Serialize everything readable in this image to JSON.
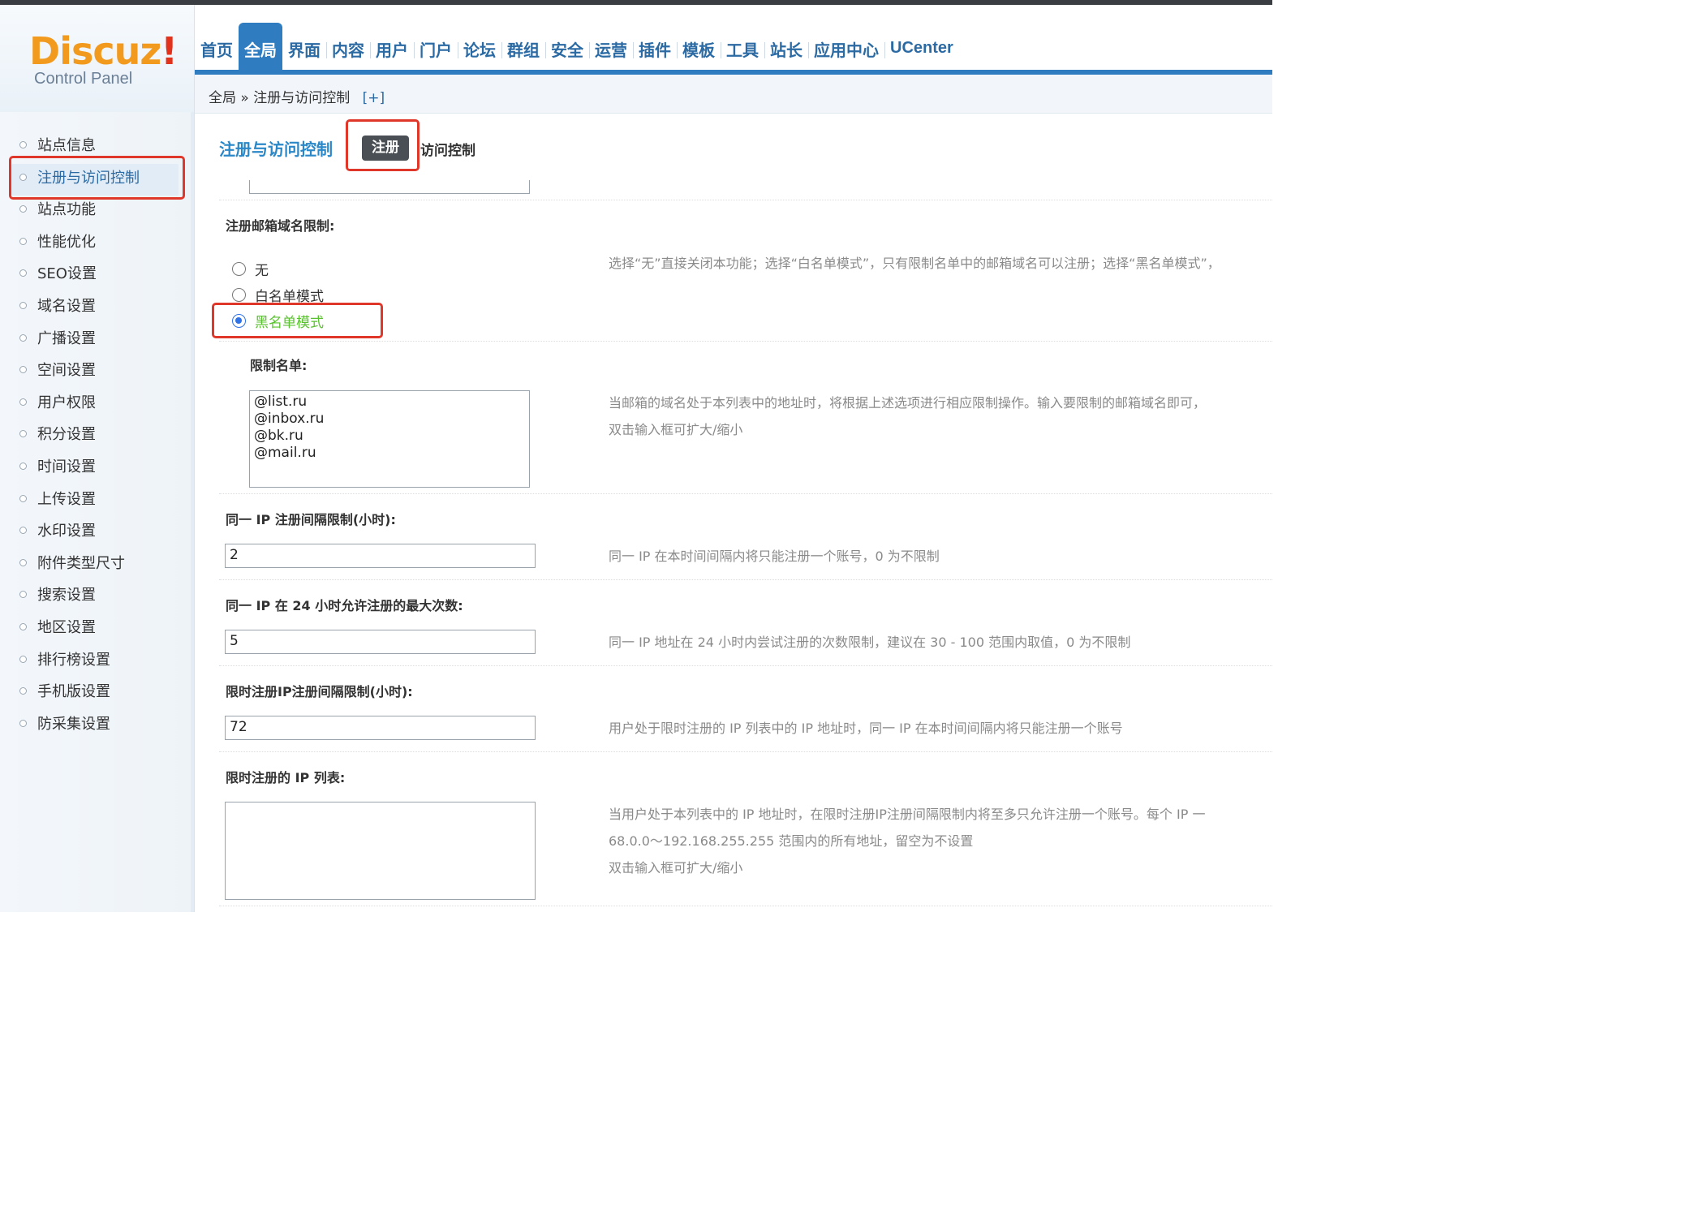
{
  "logo": {
    "brand": "Discuz",
    "bang": "!",
    "sub": "Control Panel"
  },
  "nav": {
    "items": [
      {
        "label": "首页",
        "active": false
      },
      {
        "label": "全局",
        "active": true
      },
      {
        "label": "界面",
        "active": false
      },
      {
        "label": "内容",
        "active": false
      },
      {
        "label": "用户",
        "active": false
      },
      {
        "label": "门户",
        "active": false
      },
      {
        "label": "论坛",
        "active": false
      },
      {
        "label": "群组",
        "active": false
      },
      {
        "label": "安全",
        "active": false
      },
      {
        "label": "运营",
        "active": false
      },
      {
        "label": "插件",
        "active": false
      },
      {
        "label": "模板",
        "active": false
      },
      {
        "label": "工具",
        "active": false
      },
      {
        "label": "站长",
        "active": false
      },
      {
        "label": "应用中心",
        "active": false
      },
      {
        "label": "UCenter",
        "active": false
      }
    ]
  },
  "breadcrumb": {
    "root": "全局",
    "sep": "»",
    "current": "注册与访问控制",
    "plus": "[+]"
  },
  "sidebar": {
    "items": [
      {
        "label": "站点信息",
        "active": false
      },
      {
        "label": "注册与访问控制",
        "active": true
      },
      {
        "label": "站点功能",
        "active": false
      },
      {
        "label": "性能优化",
        "active": false
      },
      {
        "label": "SEO设置",
        "active": false
      },
      {
        "label": "域名设置",
        "active": false
      },
      {
        "label": "广播设置",
        "active": false
      },
      {
        "label": "空间设置",
        "active": false
      },
      {
        "label": "用户权限",
        "active": false
      },
      {
        "label": "积分设置",
        "active": false
      },
      {
        "label": "时间设置",
        "active": false
      },
      {
        "label": "上传设置",
        "active": false
      },
      {
        "label": "水印设置",
        "active": false
      },
      {
        "label": "附件类型尺寸",
        "active": false
      },
      {
        "label": "搜索设置",
        "active": false
      },
      {
        "label": "地区设置",
        "active": false
      },
      {
        "label": "排行榜设置",
        "active": false
      },
      {
        "label": "手机版设置",
        "active": false
      },
      {
        "label": "防采集设置",
        "active": false
      }
    ]
  },
  "page": {
    "title": "注册与访问控制",
    "tab_register": "注册",
    "tab_access": "访问控制"
  },
  "email_domain": {
    "label": "注册邮箱域名限制:",
    "options": [
      "无",
      "白名单模式",
      "黑名单模式"
    ],
    "selected": "黑名单模式",
    "hint": "选择“无”直接关闭本功能；选择“白名单模式”，只有限制名单中的邮箱域名可以注册；选择“黑名单模式”，"
  },
  "restrict_list": {
    "label": "限制名单:",
    "value": [
      "@list.ru",
      "@inbox.ru",
      "@bk.ru",
      "@mail.ru"
    ],
    "hint1": "当邮箱的域名处于本列表中的地址时，将根据上述选项进行相应限制操作。输入要限制的邮箱域名即可，",
    "hint2": "双击输入框可扩大/缩小"
  },
  "ip_interval": {
    "label": "同一 IP 注册间隔限制(小时):",
    "value": "2",
    "hint": "同一 IP 在本时间间隔内将只能注册一个账号，0 为不限制"
  },
  "ip_max": {
    "label": "同一 IP 在 24 小时允许注册的最大次数:",
    "value": "5",
    "hint": "同一 IP 地址在 24 小时内尝试注册的次数限制，建议在 30 - 100 范围内取值，0 为不限制"
  },
  "limited_interval": {
    "label": "限时注册IP注册间隔限制(小时):",
    "value": "72",
    "hint": "用户处于限时注册的 IP 列表中的 IP 地址时，同一 IP 在本时间间隔内将只能注册一个账号"
  },
  "limited_list": {
    "label": "限时注册的 IP 列表:",
    "value": "",
    "hint1": "当用户处于本列表中的 IP 地址时，在限时注册IP注册间隔限制内将至多只允许注册一个账号。每个 IP 一",
    "hint2": "68.0.0～192.168.255.255 范围内的所有地址，留空为不设置",
    "hint3": "双击输入框可扩大/缩小"
  },
  "colors": {
    "accent": "#2f7cc0",
    "annotation": "#e0372b",
    "selected_text": "#5ac230"
  }
}
